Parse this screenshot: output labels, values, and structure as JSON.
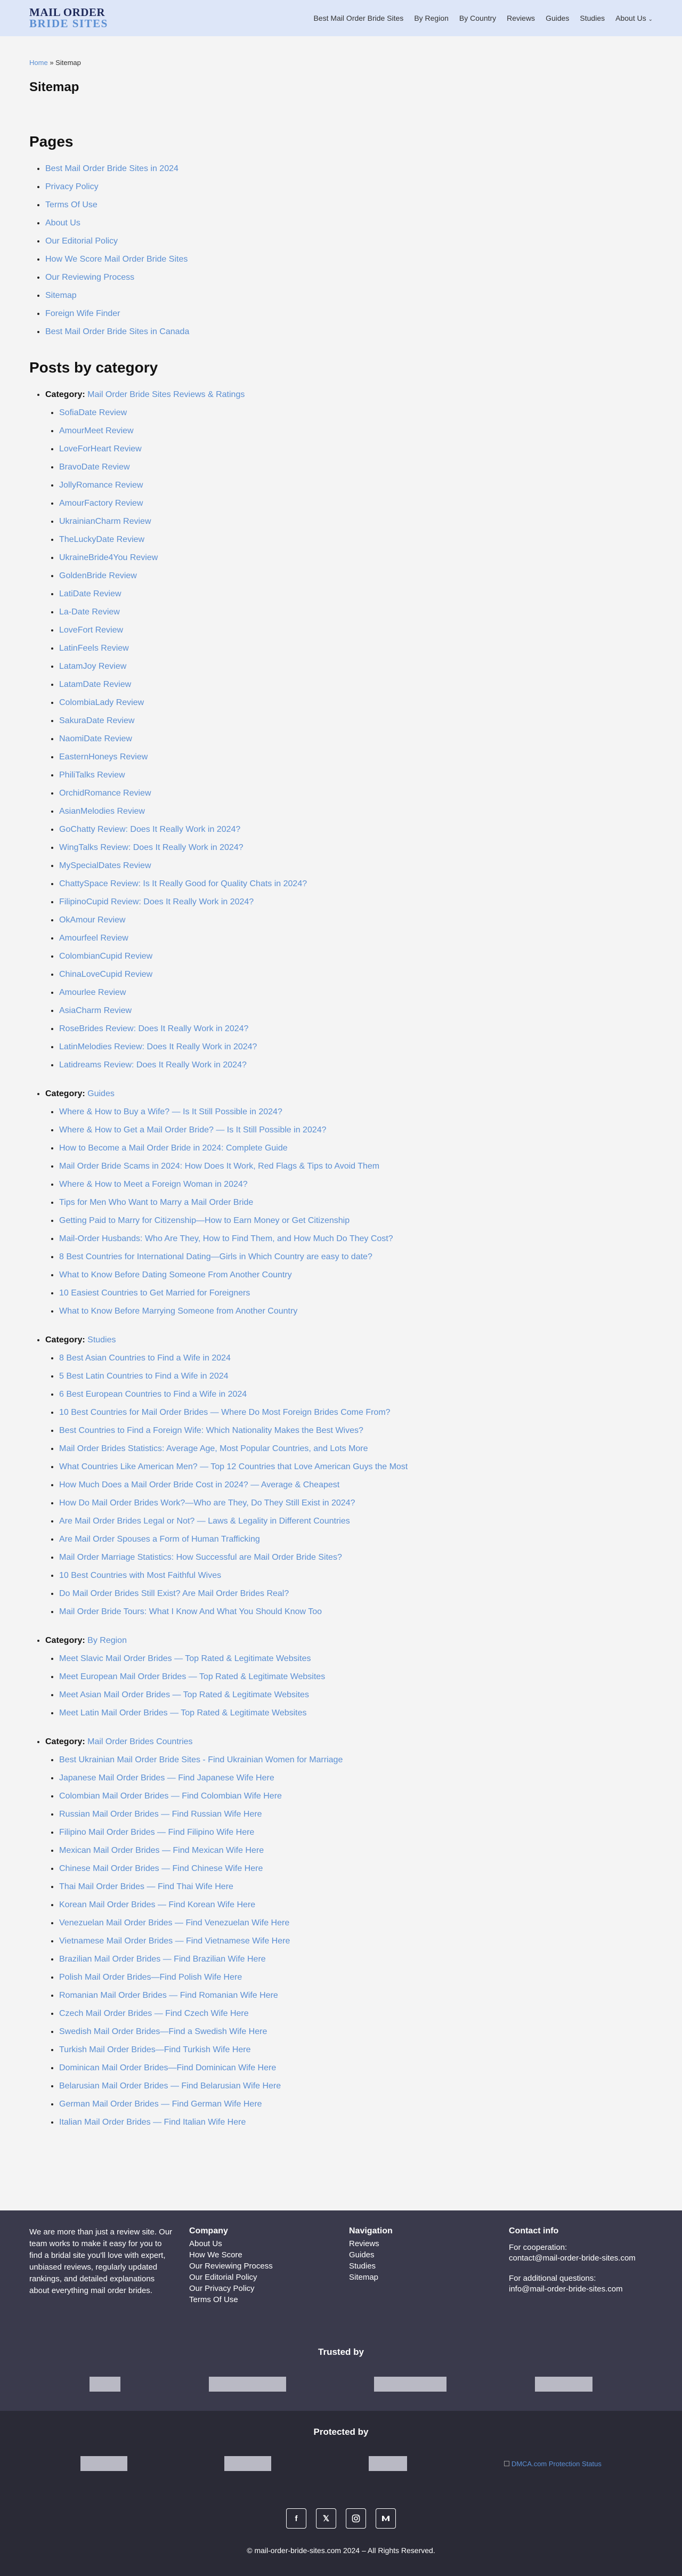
{
  "header": {
    "logo_line1": "MAIL ORDER",
    "logo_line2": "BRIDE SITES",
    "nav": [
      "Best Mail Order Bride Sites",
      "By Region",
      "By Country",
      "Reviews",
      "Guides",
      "Studies",
      "About Us"
    ]
  },
  "breadcrumb": {
    "home": "Home",
    "sep": "»",
    "current": "Sitemap"
  },
  "page_title": "Sitemap",
  "pages_heading": "Pages",
  "pages": [
    "Best Mail Order Bride Sites in 2024",
    "Privacy Policy",
    "Terms Of Use",
    "About Us",
    "Our Editorial Policy",
    "How We Score Mail Order Bride Sites",
    "Our Reviewing Process",
    "Sitemap",
    "Foreign Wife Finder",
    "Best Mail Order Bride Sites in Canada"
  ],
  "posts_heading": "Posts by category",
  "category_prefix": "Category:",
  "categories": [
    {
      "name": "Mail Order Bride Sites Reviews & Ratings",
      "posts": [
        "SofiaDate Review",
        "AmourMeet Review",
        "LoveForHeart Review",
        "BravoDate Review",
        "JollyRomance Review",
        "AmourFactory Review",
        "UkrainianCharm Review",
        "TheLuckyDate Review",
        "UkraineBride4You Review",
        "GoldenBride Review",
        "LatiDate Review",
        "La-Date Review",
        "LoveFort Review",
        "LatinFeels Review",
        "LatamJoy Review",
        "LatamDate Review",
        "ColombiaLady Review",
        "SakuraDate Review",
        "NaomiDate Review",
        "EasternHoneys Review",
        "PhiliTalks Review",
        "OrchidRomance Review",
        "AsianMelodies Review",
        "GoChatty Review: Does It Really Work in 2024?",
        "WingTalks Review: Does It Really Work in 2024?",
        "MySpecialDates Review",
        "ChattySpace Review: Is It Really Good for Quality Chats in 2024?",
        "FilipinoCupid Review: Does It Really Work in 2024?",
        "OkAmour Review",
        "Amourfeel Review",
        "ColombianCupid Review",
        "ChinaLoveCupid Review",
        "Amourlee Review",
        "AsiaCharm Review",
        "RoseBrides Review: Does It Really Work in 2024?",
        "LatinMelodies Review: Does It Really Work in 2024?",
        "Latidreams Review: Does It Really Work in 2024?"
      ]
    },
    {
      "name": "Guides",
      "posts": [
        "Where & How to Buy a Wife? — Is It Still Possible in 2024?",
        "Where & How to Get a Mail Order Bride? — Is It Still Possible in 2024?",
        "How to Become a Mail Order Bride in 2024: Complete Guide",
        "Mail Order Bride Scams in 2024: How Does It Work, Red Flags & Tips to Avoid Them",
        "Where & How to Meet a Foreign Woman in 2024?",
        "Tips for Men Who Want to Marry a Mail Order Bride",
        "Getting Paid to Marry for Citizenship—How to Earn Money or Get Citizenship",
        "Mail-Order Husbands: Who Are They, How to Find Them, and How Much Do They Cost?",
        "8 Best Countries for International Dating—Girls in Which Country are easy to date?",
        "What to Know Before Dating Someone From Another Country",
        "10 Easiest Countries to Get Married for Foreigners",
        "What to Know Before Marrying Someone from Another Country"
      ]
    },
    {
      "name": "Studies",
      "posts": [
        "8 Best Asian Countries to Find a Wife in 2024",
        "5 Best Latin Countries to Find a Wife in 2024",
        "6 Best European Countries to Find a Wife in 2024",
        "10 Best Countries for Mail Order Brides — Where Do Most Foreign Brides Come From?",
        "Best Countries to Find a Foreign Wife: Which Nationality Makes the Best Wives?",
        "Mail Order Brides Statistics: Average Age, Most Popular Countries, and Lots More",
        "What Countries Like American Men? — Top 12 Countries that Love American Guys the Most",
        "How Much Does a Mail Order Bride Cost in 2024? — Average & Cheapest",
        "How Do Mail Order Brides Work?—Who are They, Do They Still Exist in 2024?",
        "Are Mail Order Brides Legal or Not? — Laws & Legality in Different Countries",
        "Are Mail Order Spouses a Form of Human Trafficking",
        "Mail Order Marriage Statistics: How Successful are Mail Order Bride Sites?",
        "10 Best Countries with Most Faithful Wives",
        "Do Mail Order Brides Still Exist? Are Mail Order Brides Real?",
        "Mail Order Bride Tours: What I Know And What You Should Know Too"
      ]
    },
    {
      "name": "By Region",
      "posts": [
        "Meet Slavic Mail Order Brides — Top Rated & Legitimate Websites",
        "Meet European Mail Order Brides — Top Rated & Legitimate Websites",
        "Meet Asian Mail Order Brides — Top Rated & Legitimate Websites",
        "Meet Latin Mail Order Brides — Top Rated & Legitimate Websites"
      ]
    },
    {
      "name": "Mail Order Brides Countries",
      "posts": [
        "Best Ukrainian Mail Order Bride Sites - Find Ukrainian Women for Marriage",
        "Japanese Mail Order Brides — Find Japanese Wife Here",
        "Colombian Mail Order Brides — Find Colombian Wife Here",
        "Russian Mail Order Brides — Find Russian Wife Here",
        "Filipino Mail Order Brides — Find Filipino Wife Here",
        "Mexican Mail Order Brides — Find Mexican Wife Here",
        "Chinese Mail Order Brides — Find Chinese Wife Here",
        "Thai Mail Order Brides — Find Thai Wife Here",
        "Korean Mail Order Brides — Find Korean Wife Here",
        "Venezuelan Mail Order Brides — Find Venezuelan Wife Here",
        "Vietnamese Mail Order Brides — Find Vietnamese Wife Here",
        "Brazilian Mail Order Brides — Find Brazilian Wife Here",
        "Polish Mail Order Brides—Find Polish Wife Here",
        "Romanian Mail Order Brides — Find Romanian Wife Here",
        "Czech Mail Order Brides — Find Czech Wife Here",
        "Swedish Mail Order Brides—Find a Swedish Wife Here",
        "Turkish Mail Order Brides—Find Turkish Wife Here",
        "Dominican Mail Order Brides—Find Dominican Wife Here",
        "Belarusian Mail Order Brides — Find Belarusian Wife Here",
        "German Mail Order Brides — Find German Wife Here",
        "Italian Mail Order Brides — Find Italian Wife Here"
      ]
    }
  ],
  "footer": {
    "about": "We are more than just a review site. Our team works to make it easy for you to find a bridal site you'll love with expert, unbiased reviews, regularly updated rankings, and detailed explanations about everything mail order brides.",
    "company_heading": "Company",
    "company_links": [
      "About Us",
      "How We Score",
      "Our Reviewing Process",
      "Our Editorial Policy",
      "Our Privacy Policy",
      "Terms Of Use"
    ],
    "navigation_heading": "Navigation",
    "navigation_links": [
      "Reviews",
      "Guides",
      "Studies",
      "Sitemap"
    ],
    "contact_heading": "Contact info",
    "cooperation_label": "For cooperation:",
    "cooperation_email": "contact@mail-order-bride-sites.com",
    "questions_label": "For additional questions:",
    "questions_email": "info@mail-order-bride-sites.com",
    "trusted_heading": "Trusted by",
    "protected_heading": "Protected by",
    "dmca_alt": "DMCA.com Protection Status",
    "copyright": "© mail-order-bride-sites.com 2024 – All Rights Reserved."
  }
}
